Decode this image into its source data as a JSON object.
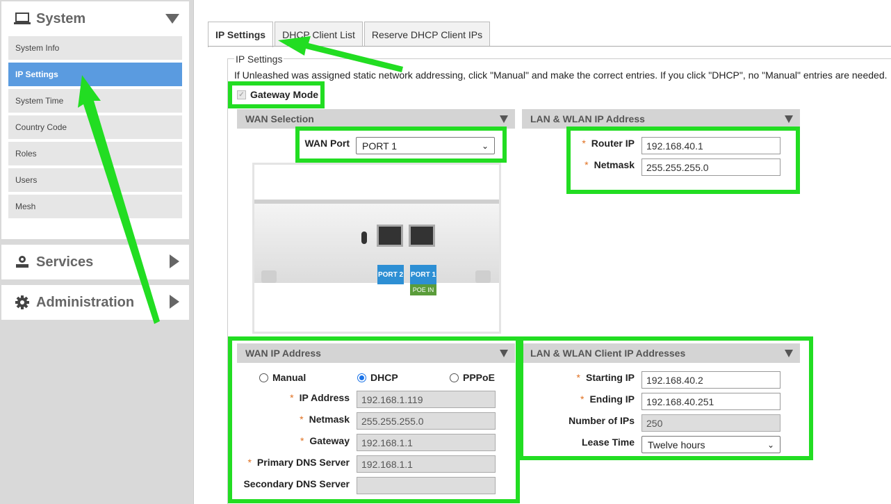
{
  "sidebar": {
    "system": {
      "title": "System",
      "items": [
        {
          "label": "System Info",
          "active": false
        },
        {
          "label": "IP Settings",
          "active": true
        },
        {
          "label": "System Time",
          "active": false
        },
        {
          "label": "Country Code",
          "active": false
        },
        {
          "label": "Roles",
          "active": false
        },
        {
          "label": "Users",
          "active": false
        },
        {
          "label": "Mesh",
          "active": false
        }
      ]
    },
    "services": {
      "title": "Services"
    },
    "administration": {
      "title": "Administration"
    }
  },
  "tabs": [
    {
      "label": "IP Settings",
      "active": true
    },
    {
      "label": "DHCP Client List",
      "active": false
    },
    {
      "label": "Reserve DHCP Client IPs",
      "active": false
    }
  ],
  "fieldset_label": "IP Settings",
  "description": "If Unleashed was assigned static network addressing, click \"Manual\" and make the correct entries. If you click \"DHCP\", no \"Manual\" entries are needed.",
  "gateway_mode": {
    "label": "Gateway Mode",
    "checked": true
  },
  "wan_selection": {
    "title": "WAN Selection",
    "port_label": "WAN Port",
    "port_value": "PORT 1",
    "device_ports": {
      "port2": "PORT 2",
      "port1": "PORT 1",
      "poe": "POE IN"
    }
  },
  "lan_wlan_ip": {
    "title": "LAN & WLAN IP Address",
    "router_ip_label": "Router IP",
    "router_ip": "192.168.40.1",
    "netmask_label": "Netmask",
    "netmask": "255.255.255.0"
  },
  "wan_ip": {
    "title": "WAN IP Address",
    "modes": {
      "manual": "Manual",
      "dhcp": "DHCP",
      "pppoe": "PPPoE"
    },
    "selected_mode": "DHCP",
    "ip_label": "IP Address",
    "ip": "192.168.1.119",
    "netmask_label": "Netmask",
    "netmask": "255.255.255.0",
    "gateway_label": "Gateway",
    "gateway": "192.168.1.1",
    "primary_dns_label": "Primary DNS Server",
    "primary_dns": "192.168.1.1",
    "secondary_dns_label": "Secondary DNS Server",
    "secondary_dns": ""
  },
  "lan_wlan_client": {
    "title": "LAN & WLAN Client IP Addresses",
    "start_label": "Starting IP",
    "start_ip": "192.168.40.2",
    "end_label": "Ending IP",
    "end_ip": "192.168.40.251",
    "count_label": "Number of IPs",
    "count": "250",
    "lease_label": "Lease Time",
    "lease": "Twelve hours"
  },
  "colors": {
    "highlight": "#22dd22",
    "active_nav": "#5a9be0",
    "required": "#e07020"
  }
}
